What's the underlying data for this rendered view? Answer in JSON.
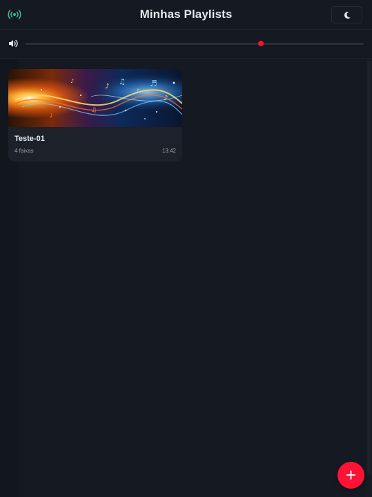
{
  "header": {
    "title": "Minhas Playlists",
    "broadcast_icon": "broadcast-icon",
    "theme_icon": "moon-icon"
  },
  "volume": {
    "icon": "speaker-volume-icon",
    "level": 0.695
  },
  "playlists": [
    {
      "name": "Teste-01",
      "tracks_label": "4 faixas",
      "duration": "13:42"
    }
  ],
  "fab": {
    "label": "+"
  },
  "colors": {
    "accent": "#ff1235",
    "broadcast": "#2fbf8c",
    "background": "#141820",
    "card": "#1d2129"
  }
}
